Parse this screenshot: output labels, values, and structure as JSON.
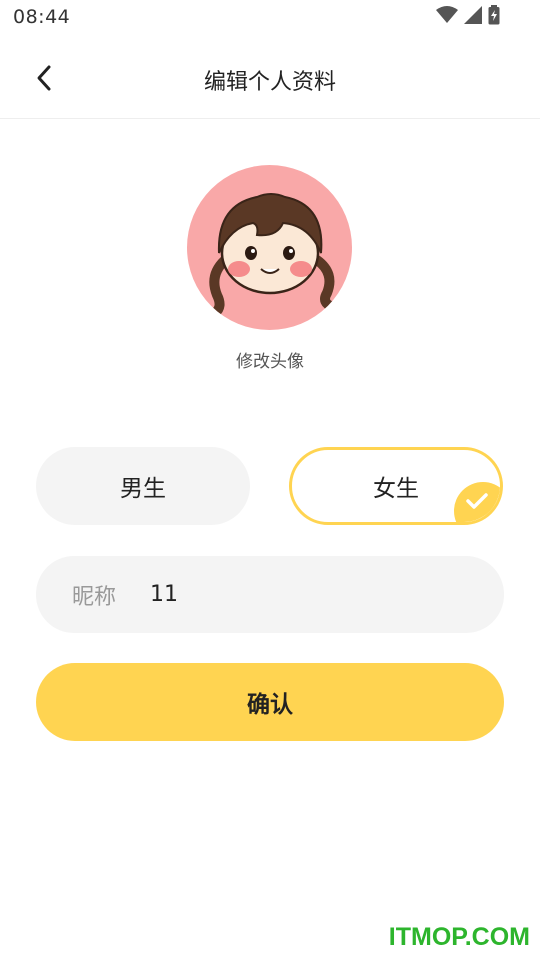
{
  "status_bar": {
    "time": "08:44",
    "icons": [
      "wifi-icon",
      "signal-icon",
      "battery-icon"
    ]
  },
  "header": {
    "title": "编辑个人资料",
    "back_icon": "chevron-left-icon"
  },
  "avatar": {
    "caption": "修改头像",
    "background_color": "#f9a8a8"
  },
  "gender": {
    "male_label": "男生",
    "female_label": "女生",
    "selected": "female"
  },
  "nickname": {
    "label": "昵称",
    "value": "11"
  },
  "confirm_label": "确认",
  "watermark": "ITMOP.COM",
  "colors": {
    "accent": "#ffd451",
    "field_bg": "#f4f4f4",
    "watermark": "#2db52d"
  }
}
